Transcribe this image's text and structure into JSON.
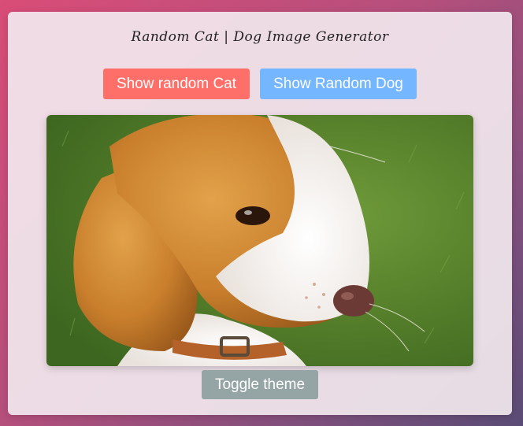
{
  "app": {
    "title": "Random Cat | Dog Image Generator"
  },
  "buttons": {
    "cat_label": "Show random Cat",
    "dog_label": "Show Random Dog",
    "theme_label": "Toggle theme"
  },
  "image": {
    "alt": "puppy-photo"
  },
  "colors": {
    "cat_button": "#ff6f69",
    "dog_button": "#74b6ff",
    "theme_button": "#95a5a6"
  }
}
